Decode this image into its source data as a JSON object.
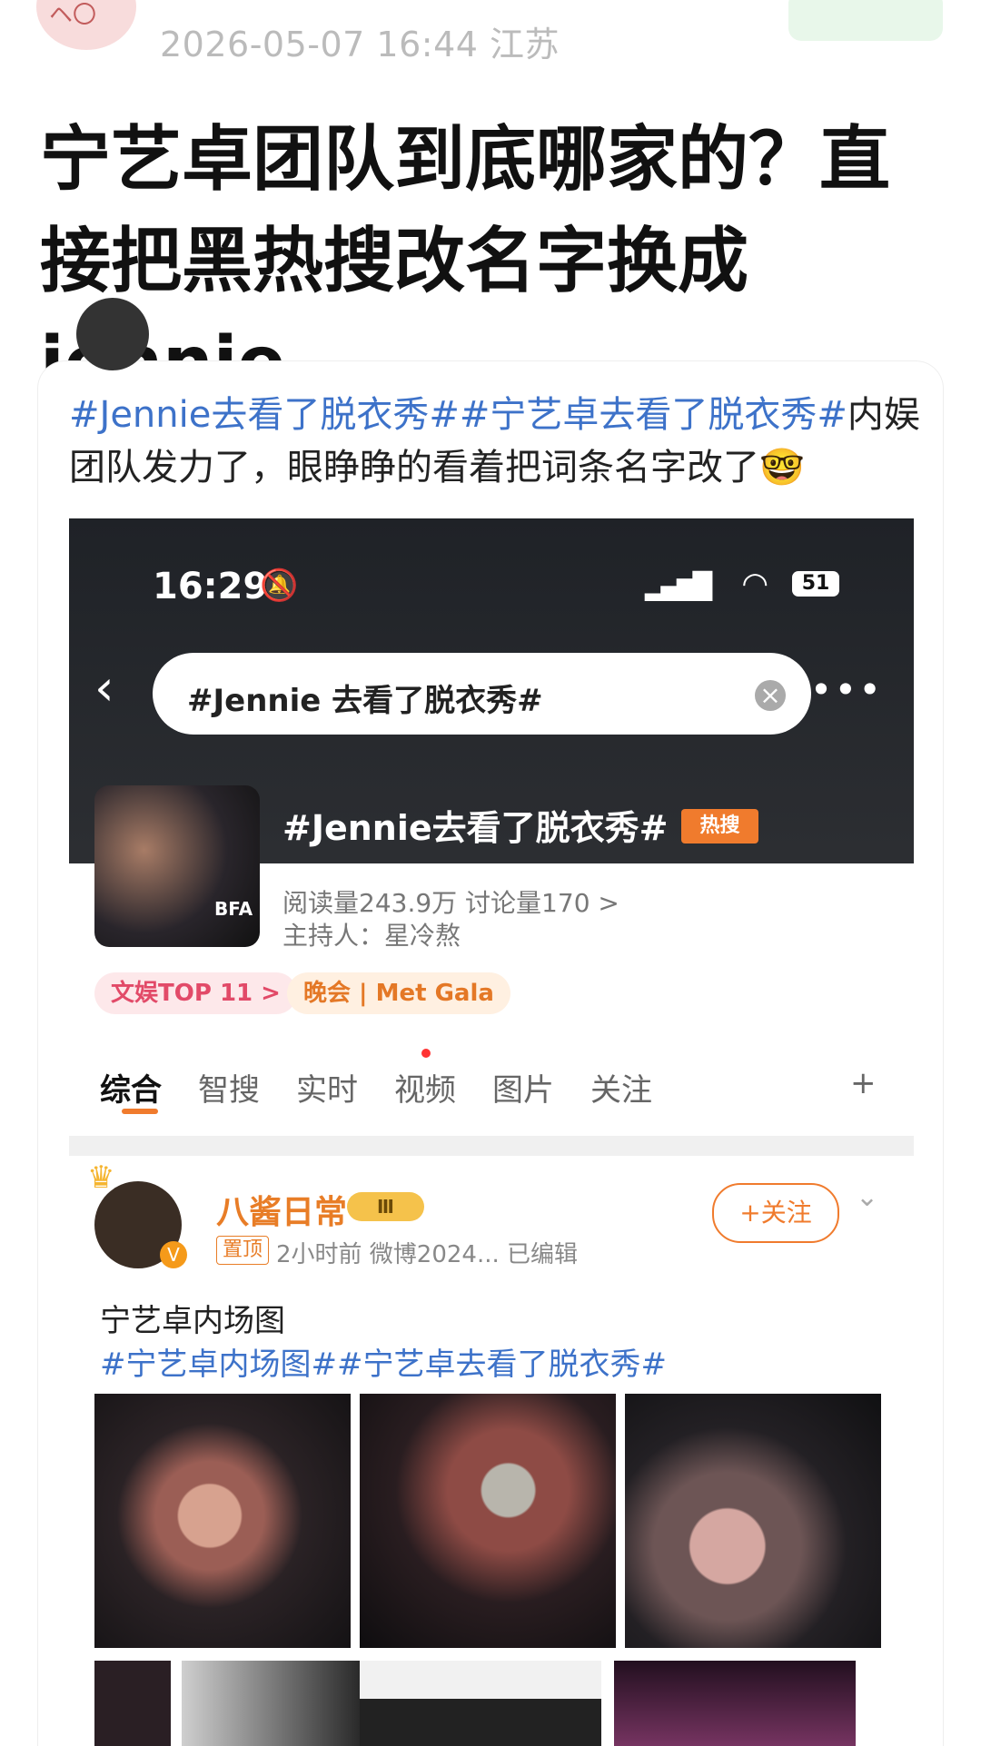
{
  "header": {
    "meta": "2026-05-07 16:44 江苏"
  },
  "article": {
    "title": "宁艺卓团队到底哪家的？直接把黑热搜改名字换成jennie",
    "post_text_tag1": "#Jennie去看了脱衣秀#",
    "post_text_tag2": "#宁艺卓去看了脱衣秀#",
    "post_text_rest": "内娱团队发力了，眼睁睁的看着把词条名字改了🤓"
  },
  "screenshot": {
    "status_time": "16:29",
    "battery": "51",
    "search_text": "#Jennie 去看了脱衣秀#",
    "topic_title": "#Jennie去看了脱衣秀#",
    "hot_badge": "热搜",
    "topic_image_label": "BFA",
    "stats": "阅读量243.9万  讨论量170  >",
    "host": "主持人：星冷熬",
    "chip1": "文娱TOP 11 >",
    "chip2": "晚会 | Met Gala",
    "tabs": [
      "综合",
      "智搜",
      "实时",
      "视频",
      "图片",
      "关注",
      "+"
    ],
    "post_name": "八酱日常",
    "pin_label": "置顶",
    "post_meta": "2小时前  微博2024...  已编辑",
    "follow_label": "+关注",
    "post_body": "宁艺卓内场图",
    "post_tags": "#宁艺卓内场图##宁艺卓去看了脱衣秀#"
  },
  "colors": {
    "accent": "#f07b2d",
    "link": "#3d72c9"
  }
}
